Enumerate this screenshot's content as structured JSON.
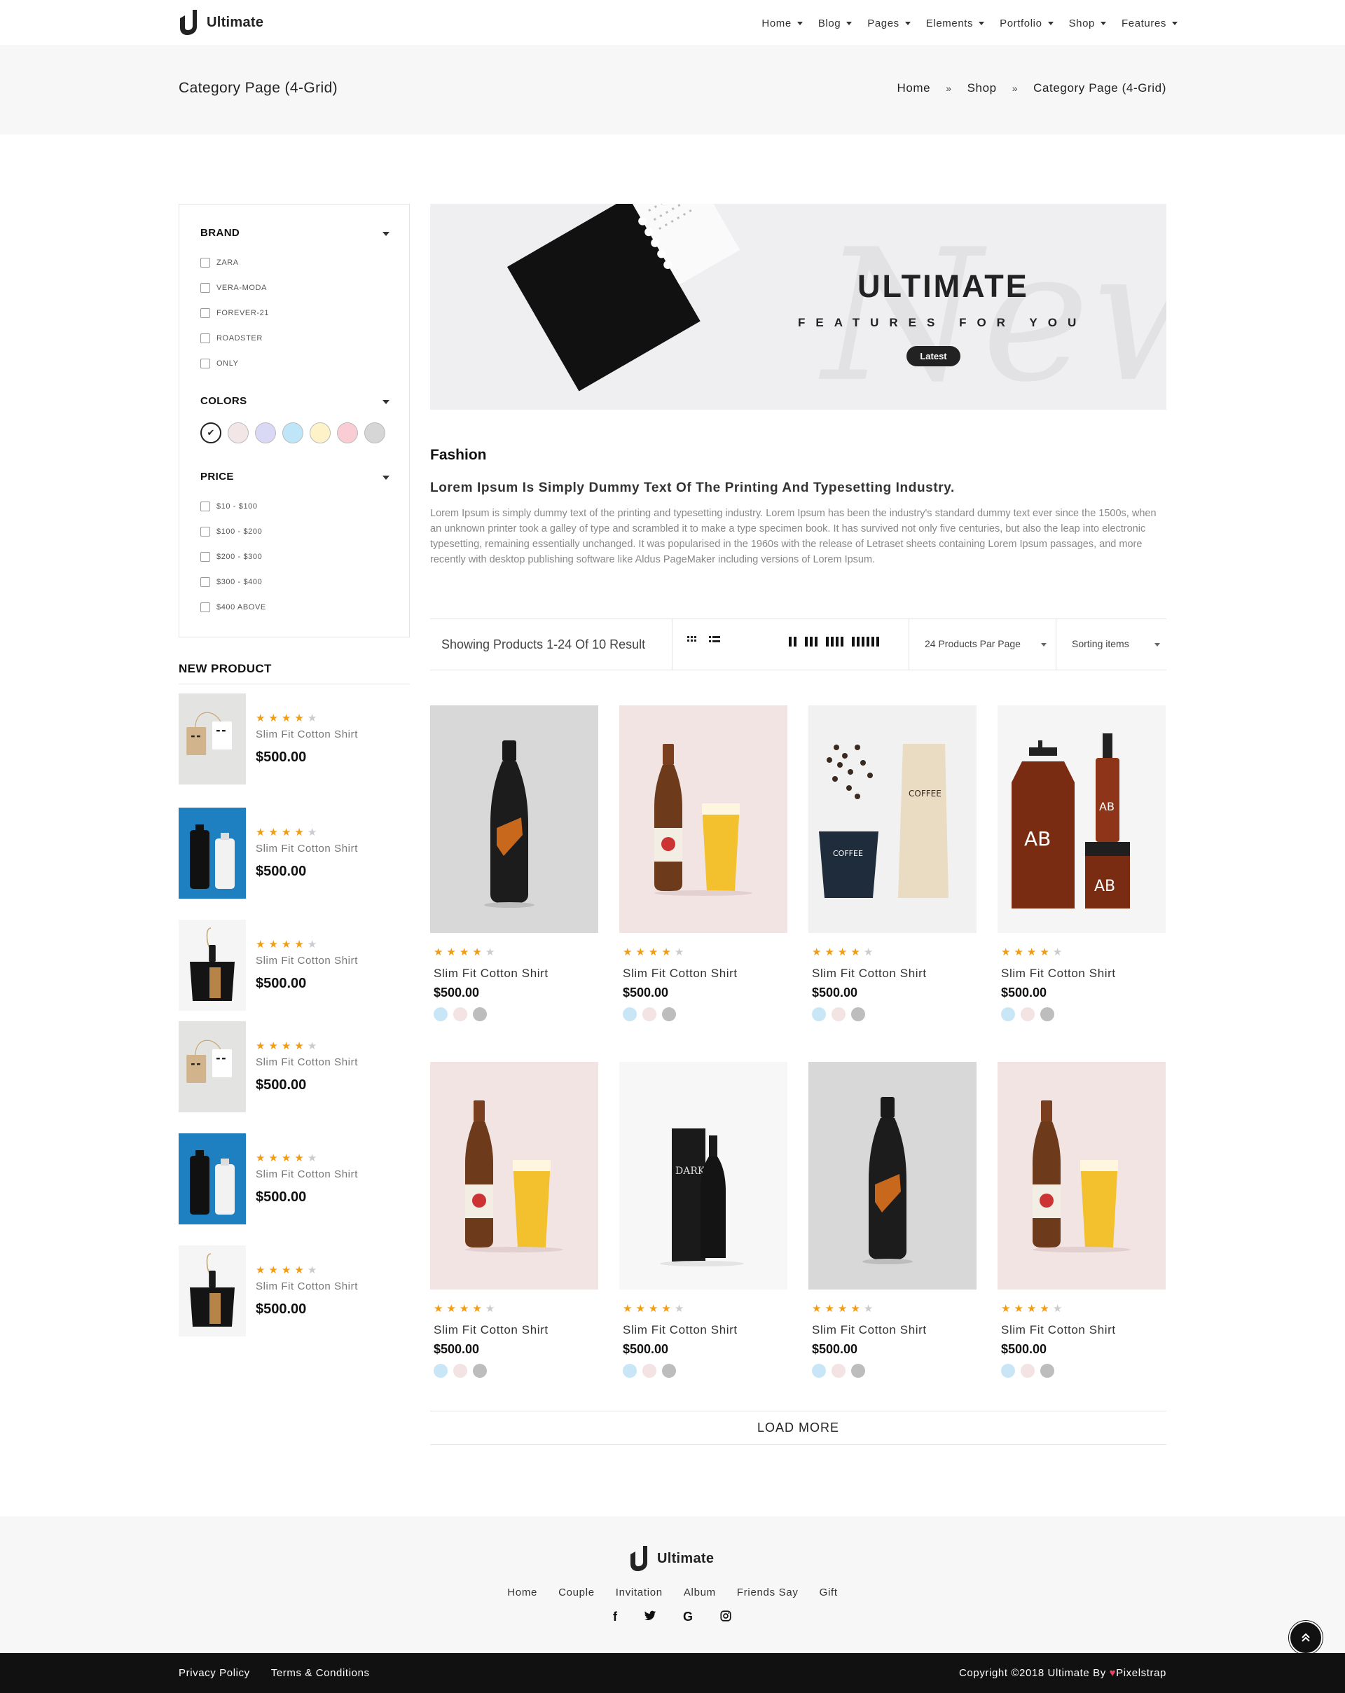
{
  "header": {
    "logo": "Ultimate",
    "nav": [
      "Home",
      "Blog",
      "Pages",
      "Elements",
      "Portfolio",
      "Shop",
      "Features"
    ]
  },
  "band": {
    "title": "Category Page (4-Grid)",
    "crumbs": [
      "Home",
      "Shop",
      "Category Page (4-Grid)"
    ],
    "sep": "»"
  },
  "filter": {
    "brand": {
      "title": "BRAND",
      "items": [
        "ZARA",
        "VERA-MODA",
        "FOREVER-21",
        "ROADSTER",
        "ONLY"
      ]
    },
    "colors": {
      "title": "COLORS",
      "swatches": [
        "#ffffff",
        "#f3e6e6",
        "#d9d9f5",
        "#bfe6f8",
        "#fdf2c8",
        "#f9cdd3",
        "#d6d6d6"
      ]
    },
    "price": {
      "title": "PRICE",
      "items": [
        "$10 - $100",
        "$100 - $200",
        "$200 - $300",
        "$300 - $400",
        "$400 ABOVE"
      ]
    }
  },
  "new_product": {
    "title": "NEW PRODUCT",
    "items": [
      {
        "name": "Slim Fit Cotton Shirt",
        "price": "$500.00",
        "rating": 4,
        "img": "tags"
      },
      {
        "name": "Slim Fit Cotton Shirt",
        "price": "$500.00",
        "rating": 4,
        "img": "bottles-blue"
      },
      {
        "name": "Slim Fit Cotton Shirt",
        "price": "$500.00",
        "rating": 4,
        "img": "dustpan"
      },
      {
        "name": "Slim Fit Cotton Shirt",
        "price": "$500.00",
        "rating": 4,
        "img": "tags"
      },
      {
        "name": "Slim Fit Cotton Shirt",
        "price": "$500.00",
        "rating": 4,
        "img": "bottles-blue"
      },
      {
        "name": "Slim Fit Cotton Shirt",
        "price": "$500.00",
        "rating": 4,
        "img": "dustpan"
      }
    ]
  },
  "banner": {
    "title": "ULTIMATE",
    "subtitle": "FEATURES FOR YOU",
    "button": "Latest"
  },
  "fashion": {
    "heading": "Fashion",
    "subheading": "Lorem Ipsum Is Simply Dummy Text Of The Printing And Typesetting Industry.",
    "body": "Lorem Ipsum is simply dummy text of the printing and typesetting industry. Lorem Ipsum has been the industry's standard dummy text ever since the 1500s, when an unknown printer took a galley of type and scrambled it to make a type specimen book. It has survived not only five centuries, but also the leap into electronic typesetting, remaining essentially unchanged. It was popularised in the 1960s with the release of Letraset sheets containing Lorem Ipsum passages, and more recently with desktop publishing software like Aldus PageMaker including versions of Lorem Ipsum."
  },
  "toolbar": {
    "result": "Showing Products 1-24 Of 10 Result",
    "per_page": "24 Products Par Page",
    "sorting": "Sorting items"
  },
  "products": [
    {
      "name": "Slim Fit Cotton Shirt",
      "price": "$500.00",
      "rating": 4,
      "img": "black-bottle",
      "colors": [
        "#c9e6f7",
        "#f3e3e3",
        "#bdbdbd"
      ]
    },
    {
      "name": "Slim Fit Cotton Shirt",
      "price": "$500.00",
      "rating": 4,
      "img": "beer",
      "colors": [
        "#c9e6f7",
        "#f3e3e3",
        "#bdbdbd"
      ]
    },
    {
      "name": "Slim Fit Cotton Shirt",
      "price": "$500.00",
      "rating": 4,
      "img": "coffee",
      "colors": [
        "#c9e6f7",
        "#f3e3e3",
        "#bdbdbd"
      ]
    },
    {
      "name": "Slim Fit Cotton Shirt",
      "price": "$500.00",
      "rating": 4,
      "img": "amber",
      "colors": [
        "#c9e6f7",
        "#f3e3e3",
        "#bdbdbd"
      ]
    },
    {
      "name": "Slim Fit Cotton Shirt",
      "price": "$500.00",
      "rating": 4,
      "img": "beer",
      "colors": [
        "#c9e6f7",
        "#f3e3e3",
        "#bdbdbd"
      ]
    },
    {
      "name": "Slim Fit Cotton Shirt",
      "price": "$500.00",
      "rating": 4,
      "img": "wine",
      "colors": [
        "#c9e6f7",
        "#f3e3e3",
        "#bdbdbd"
      ]
    },
    {
      "name": "Slim Fit Cotton Shirt",
      "price": "$500.00",
      "rating": 4,
      "img": "black-bottle",
      "colors": [
        "#c9e6f7",
        "#f3e3e3",
        "#bdbdbd"
      ]
    },
    {
      "name": "Slim Fit Cotton Shirt",
      "price": "$500.00",
      "rating": 4,
      "img": "beer",
      "colors": [
        "#c9e6f7",
        "#f3e3e3",
        "#bdbdbd"
      ]
    }
  ],
  "load_more": "LOAD MORE",
  "footer": {
    "logo": "Ultimate",
    "links": [
      "Home",
      "Couple",
      "Invitation",
      "Album",
      "Friends Say",
      "Gift"
    ],
    "social": [
      "facebook-icon",
      "twitter-icon",
      "google-icon",
      "instagram-icon"
    ]
  },
  "bottom": {
    "links": [
      "Privacy Policy",
      "Terms & Conditions"
    ],
    "copyright": "Copyright ©2018 Ultimate By",
    "brand": "Pixelstrap"
  },
  "colors": {
    "accent": "#f39c12",
    "dark": "#111111",
    "band": "#f7f7f8"
  }
}
